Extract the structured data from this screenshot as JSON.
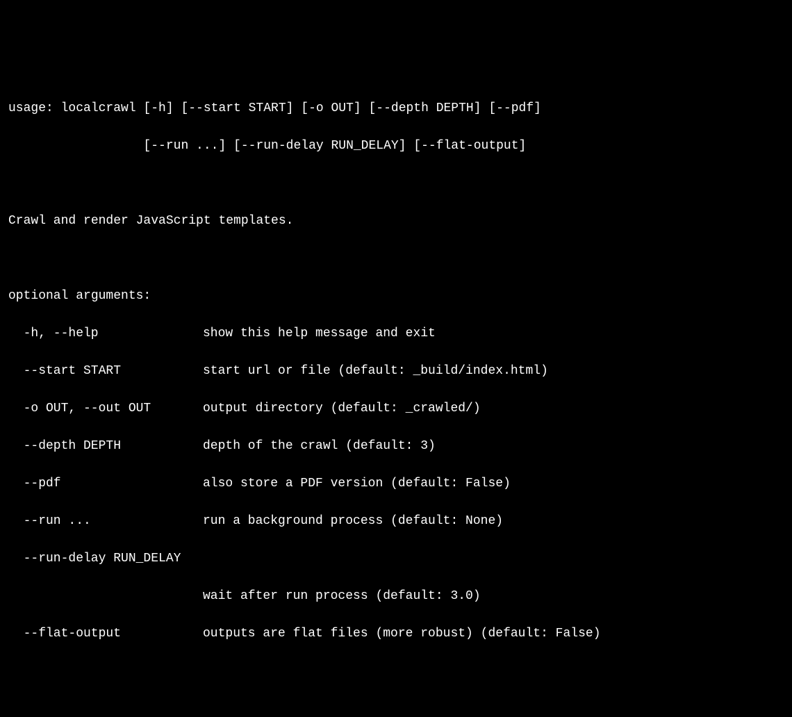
{
  "usage": {
    "line1": "usage: localcrawl [-h] [--start START] [-o OUT] [--depth DEPTH] [--pdf]",
    "line2": "                  [--run ...] [--run-delay RUN_DELAY] [--flat-output]"
  },
  "description": "Crawl and render JavaScript templates.",
  "section_header": "optional arguments:",
  "args": [
    {
      "flag": "-h, --help",
      "desc": "show this help message and exit"
    },
    {
      "flag": "--start START",
      "desc": "start url or file (default: _build/index.html)"
    },
    {
      "flag": "-o OUT, --out OUT",
      "desc": "output directory (default: _crawled/)"
    },
    {
      "flag": "--depth DEPTH",
      "desc": "depth of the crawl (default: 3)"
    },
    {
      "flag": "--pdf",
      "desc": "also store a PDF version (default: False)"
    },
    {
      "flag": "--run ...",
      "desc": "run a background process (default: None)"
    },
    {
      "flag": "--run-delay RUN_DELAY",
      "desc": ""
    }
  ],
  "run_delay_desc": "wait after run process (default: 3.0)",
  "flat_output": {
    "flag": "--flat-output",
    "desc": "outputs are flat files (more robust) (default: False)"
  }
}
